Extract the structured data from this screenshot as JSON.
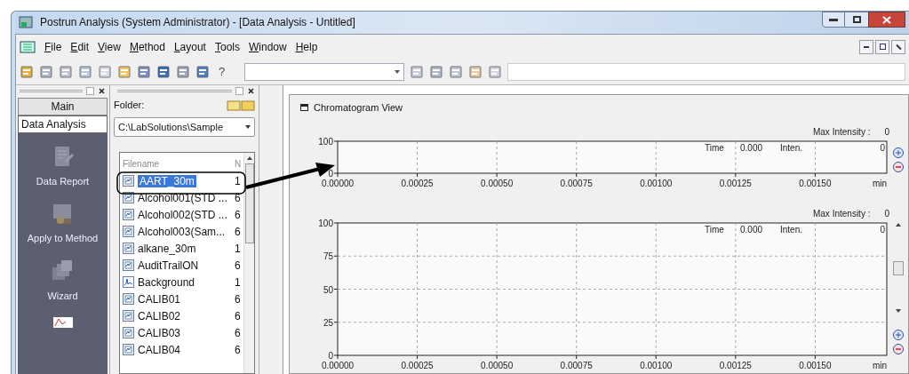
{
  "window": {
    "title": "Postrun Analysis (System Administrator) - [Data Analysis - Untitled]"
  },
  "menu": [
    "File",
    "Edit",
    "View",
    "Method",
    "Layout",
    "Tools",
    "Window",
    "Help"
  ],
  "toolbar": {
    "help": "?"
  },
  "sidebar": {
    "tabs": [
      {
        "label": "Main",
        "selected": false
      },
      {
        "label": "Data Analysis",
        "selected": true
      }
    ],
    "items": [
      {
        "label": "Data Report",
        "kind": "report"
      },
      {
        "label": "Apply to Method",
        "kind": "apply"
      },
      {
        "label": "Wizard",
        "kind": "wizard"
      }
    ]
  },
  "folder_panel": {
    "label": "Folder:",
    "path": "C:\\LabSolutions\\Sample",
    "columns": [
      "Filename",
      "N"
    ],
    "files": [
      {
        "name": "AART_30m",
        "column_2": "1",
        "kind": "data",
        "selected": true
      },
      {
        "name": "Alcohol001(STD ...",
        "column_2": "6",
        "kind": "data",
        "selected": false
      },
      {
        "name": "Alcohol002(STD ...",
        "column_2": "6",
        "kind": "data",
        "selected": false
      },
      {
        "name": "Alcohol003(Sam...",
        "column_2": "6",
        "kind": "data",
        "selected": false
      },
      {
        "name": "alkane_30m",
        "column_2": "1",
        "kind": "data",
        "selected": false
      },
      {
        "name": "AuditTrailON",
        "column_2": "6",
        "kind": "data",
        "selected": false
      },
      {
        "name": "Background",
        "column_2": "1",
        "kind": "background",
        "selected": false
      },
      {
        "name": "CALIB01",
        "column_2": "6",
        "kind": "data",
        "selected": false
      },
      {
        "name": "CALIB02",
        "column_2": "6",
        "kind": "data",
        "selected": false
      },
      {
        "name": "CALIB03",
        "column_2": "6",
        "kind": "data",
        "selected": false
      },
      {
        "name": "CALIB04",
        "column_2": "6",
        "kind": "data",
        "selected": false
      }
    ]
  },
  "chromatogram_view": {
    "title": "Chromatogram View",
    "charts": [
      {
        "max_intensity_label": "Max Intensity :",
        "max_intensity": "0",
        "time_label": "Time",
        "time": "0.000",
        "inten_label": "Inten.",
        "inten": "0",
        "scrollbar": false,
        "chart_data": {
          "type": "line",
          "grid": true,
          "xlabel": "min",
          "xlim": [
            0,
            0.001725
          ],
          "ylim": [
            0,
            100
          ],
          "xticks": [
            {
              "value": 0,
              "label": "0.00000"
            },
            {
              "value": 0.00025,
              "label": "0.00025"
            },
            {
              "value": 0.0005,
              "label": "0.00050"
            },
            {
              "value": 0.00075,
              "label": "0.00075"
            },
            {
              "value": 0.001,
              "label": "0.00100"
            },
            {
              "value": 0.00125,
              "label": "0.00125"
            },
            {
              "value": 0.0015,
              "label": "0.00150"
            }
          ],
          "yticks": [
            {
              "value": 0,
              "label": "0"
            },
            {
              "value": 100,
              "label": "100"
            }
          ]
        }
      },
      {
        "max_intensity_label": "Max Intensity :",
        "max_intensity": "0",
        "time_label": "Time",
        "time": "0.000",
        "inten_label": "Inten.",
        "inten": "0",
        "scrollbar": true,
        "chart_data": {
          "type": "line",
          "grid": true,
          "xlabel": "min",
          "xlim": [
            0,
            0.001725
          ],
          "ylim": [
            0,
            100
          ],
          "xticks": [
            {
              "value": 0,
              "label": "0.00000"
            },
            {
              "value": 0.00025,
              "label": "0.00025"
            },
            {
              "value": 0.0005,
              "label": "0.00050"
            },
            {
              "value": 0.00075,
              "label": "0.00075"
            },
            {
              "value": 0.001,
              "label": "0.00100"
            },
            {
              "value": 0.00125,
              "label": "0.00125"
            },
            {
              "value": 0.0015,
              "label": "0.00150"
            }
          ],
          "yticks": [
            {
              "value": 0,
              "label": "0"
            },
            {
              "value": 25,
              "label": "25"
            },
            {
              "value": 50,
              "label": "50"
            },
            {
              "value": 75,
              "label": "75"
            },
            {
              "value": 100,
              "label": "100"
            }
          ]
        }
      }
    ]
  }
}
